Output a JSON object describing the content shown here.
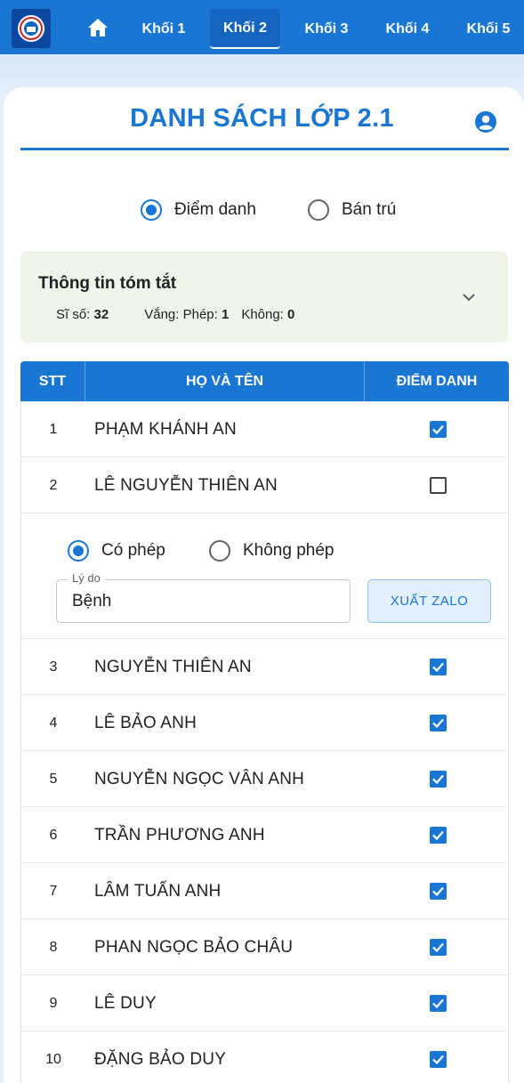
{
  "nav": {
    "tabs": [
      {
        "label": "Khối 1",
        "active": false
      },
      {
        "label": "Khối 2",
        "active": true
      },
      {
        "label": "Khối 3",
        "active": false
      },
      {
        "label": "Khối 4",
        "active": false
      },
      {
        "label": "Khối 5",
        "active": false
      }
    ]
  },
  "page": {
    "title": "DANH SÁCH LỚP 2.1"
  },
  "mode": {
    "options": [
      {
        "label": "Điểm danh",
        "selected": true
      },
      {
        "label": "Bán trú",
        "selected": false
      }
    ]
  },
  "summary": {
    "title": "Thông tin tóm tắt",
    "si_so_label": "Sĩ số:",
    "si_so_value": "32",
    "vang_label": "Vắng:",
    "phep_label": "Phép:",
    "phep_value": "1",
    "khong_label": "Không:",
    "khong_value": "0"
  },
  "table": {
    "headers": {
      "stt": "STT",
      "name": "HỌ VÀ TÊN",
      "attendance": "ĐIỂM DANH"
    },
    "rows": [
      {
        "stt": "1",
        "name": "PHẠM KHÁNH AN",
        "present": true
      },
      {
        "stt": "2",
        "name": "LÊ NGUYỄN THIÊN AN",
        "present": false
      },
      {
        "stt": "3",
        "name": "NGUYỄN THIÊN AN",
        "present": true
      },
      {
        "stt": "4",
        "name": "LÊ BẢO ANH",
        "present": true
      },
      {
        "stt": "5",
        "name": "NGUYỄN NGỌC VÂN ANH",
        "present": true
      },
      {
        "stt": "6",
        "name": "TRẦN PHƯƠNG ANH",
        "present": true
      },
      {
        "stt": "7",
        "name": "LÂM TUẤN ANH",
        "present": true
      },
      {
        "stt": "8",
        "name": "PHAN NGỌC BẢO CHÂU",
        "present": true
      },
      {
        "stt": "9",
        "name": "LÊ DUY",
        "present": true
      },
      {
        "stt": "10",
        "name": "ĐẶNG BẢO DUY",
        "present": true
      }
    ]
  },
  "absence": {
    "options": [
      {
        "label": "Có phép",
        "selected": true
      },
      {
        "label": "Không phép",
        "selected": false
      }
    ],
    "reason_label": "Lý do",
    "reason_value": "Bệnh",
    "export_label": "XUẤT ZALO"
  },
  "colors": {
    "primary": "#1976d2",
    "summary_bg": "#eef5e9"
  }
}
